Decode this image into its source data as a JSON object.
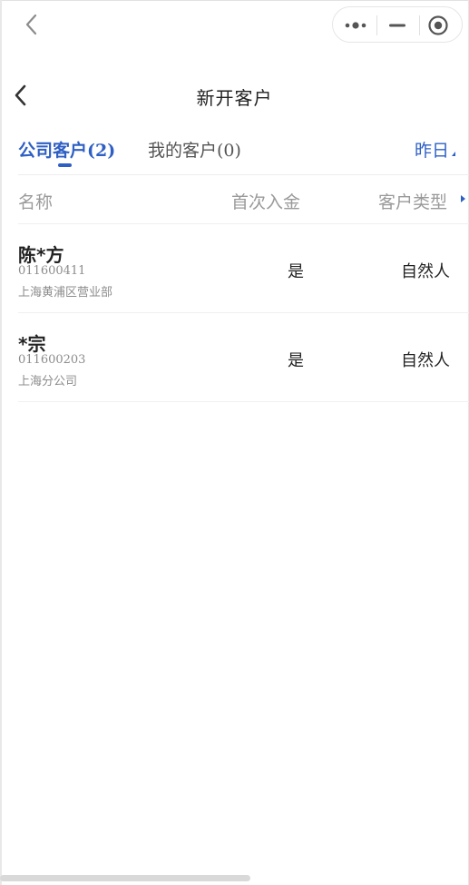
{
  "topbar": {
    "back_icon": "chevron-left-icon",
    "capsule": {
      "more_icon": "more-dots-icon",
      "minimize_icon": "minimize-icon",
      "close_icon": "target-close-icon"
    }
  },
  "header": {
    "title": "新开客户",
    "back_icon": "chevron-left-icon"
  },
  "tabs": [
    {
      "label": "公司客户",
      "count": "(2)",
      "active": true
    },
    {
      "label": "我的客户",
      "count": "(0)",
      "active": false
    }
  ],
  "date_filter": {
    "label": "昨日"
  },
  "table": {
    "columns": [
      "名称",
      "首次入金",
      "客户类型"
    ],
    "rows": [
      {
        "name": "陈*方",
        "code": "011600411",
        "branch": "上海黄浦区营业部",
        "first_deposit": "是",
        "client_type": "自然人"
      },
      {
        "name": "*宗",
        "code": "011600203",
        "branch": "上海分公司",
        "first_deposit": "是",
        "client_type": "自然人"
      }
    ]
  },
  "colors": {
    "accent": "#2e5fc4",
    "muted_text": "#9a9a9a",
    "divider": "#f0f0f0"
  }
}
